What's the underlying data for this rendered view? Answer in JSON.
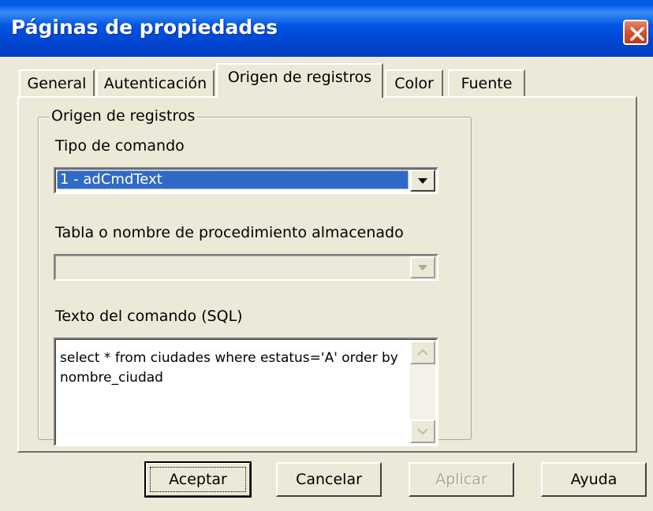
{
  "window": {
    "title": "Páginas de propiedades",
    "close_icon": "close-icon"
  },
  "tabs": [
    {
      "label": "General",
      "active": false
    },
    {
      "label": "Autenticación",
      "active": false
    },
    {
      "label": "Origen de registros",
      "active": true
    },
    {
      "label": "Color",
      "active": false
    },
    {
      "label": "Fuente",
      "active": false
    }
  ],
  "group": {
    "legend": "Origen de registros",
    "command_type_label": "Tipo de comando",
    "command_type_value": "1 - adCmdText",
    "table_label": "Tabla o nombre de procedimiento almacenado",
    "table_value": "",
    "sql_label": "Texto del comando (SQL)",
    "sql_value": "select * from ciudades where estatus='A' order by nombre_ciudad"
  },
  "buttons": {
    "ok": "Aceptar",
    "cancel": "Cancelar",
    "apply": "Aplicar",
    "help": "Ayuda"
  },
  "colors": {
    "titlebar": "#0054e3",
    "dialog_face": "#ece9d8",
    "selection": "#316ac5",
    "close_button": "#d9532c"
  }
}
